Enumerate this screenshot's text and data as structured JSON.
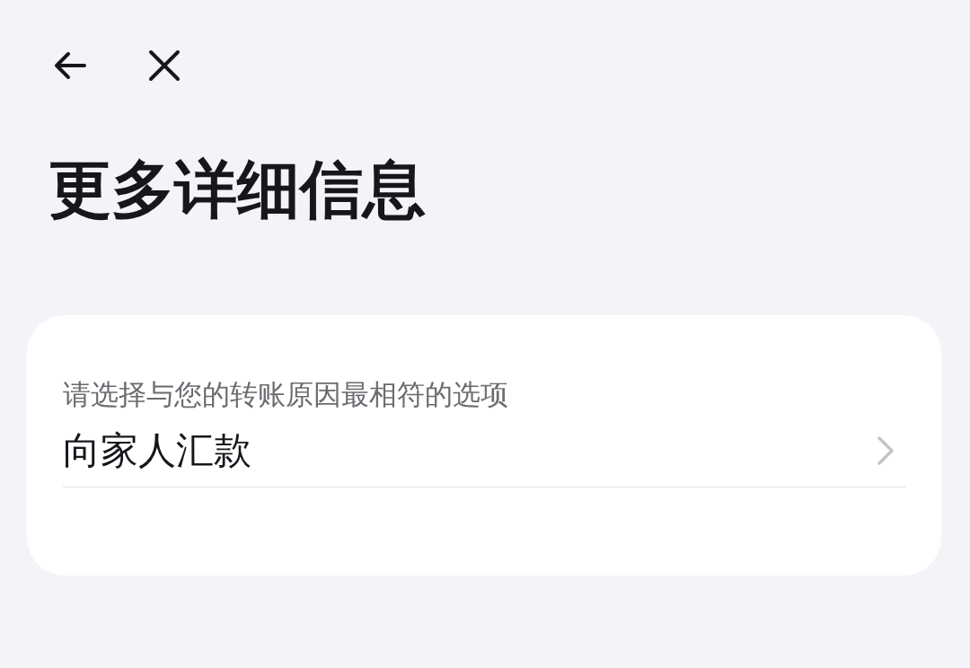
{
  "title": "更多详细信息",
  "field": {
    "label": "请选择与您的转账原因最相符的选项",
    "value": "向家人汇款"
  }
}
